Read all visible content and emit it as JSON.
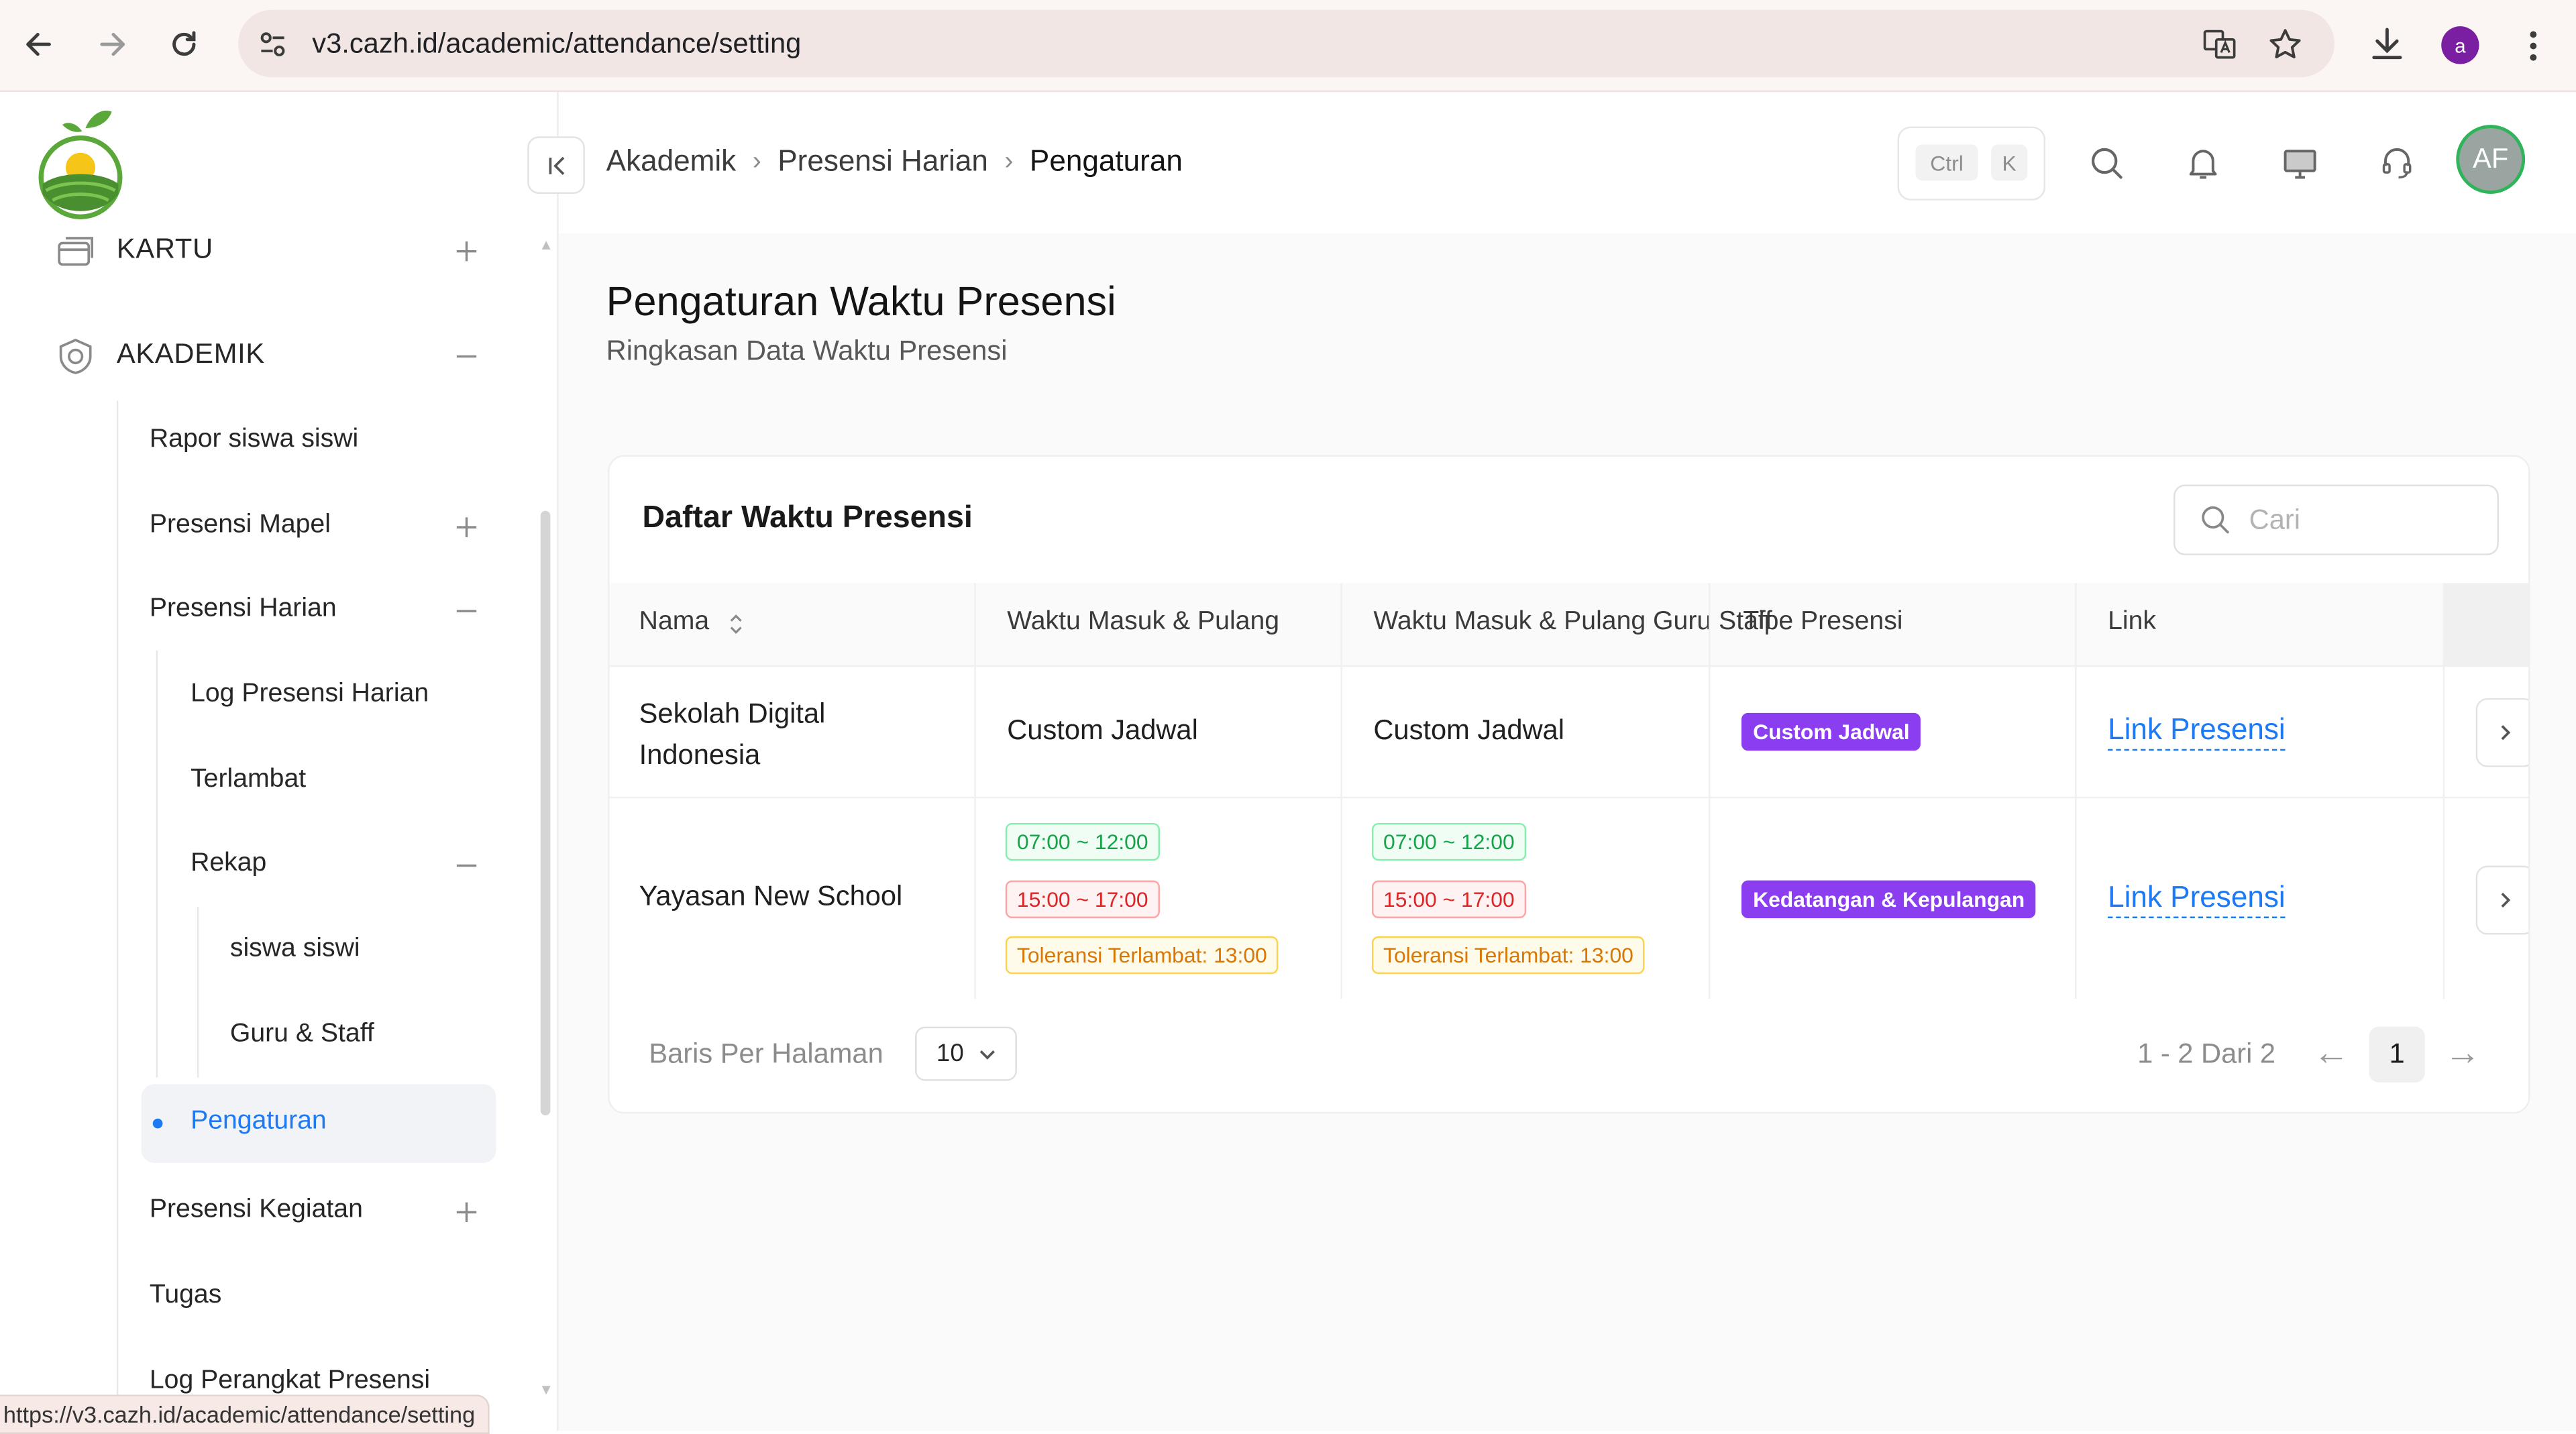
{
  "browser": {
    "url": "v3.cazh.id/academic/attendance/setting",
    "profile_initial": "a",
    "status_url": "https://v3.cazh.id/academic/attendance/setting"
  },
  "sidebar": {
    "kartu": "KARTU",
    "akademik": "AKADEMIK",
    "items": {
      "rapor": "Rapor siswa siswi",
      "presensi_mapel": "Presensi Mapel",
      "presensi_harian": "Presensi Harian",
      "log_harian": "Log Presensi Harian",
      "terlambat": "Terlambat",
      "rekap": "Rekap",
      "siswa": "siswa siswi",
      "guru": "Guru & Staff",
      "pengaturan": "Pengaturan",
      "presensi_kegiatan": "Presensi Kegiatan",
      "tugas": "Tugas",
      "log_perangkat": "Log Perangkat Presensi"
    }
  },
  "header": {
    "breadcrumbs": [
      "Akademik",
      "Presensi Harian",
      "Pengaturan"
    ],
    "kbd_ctrl": "Ctrl",
    "kbd_k": "K",
    "avatar": "AF"
  },
  "page": {
    "title": "Pengaturan Waktu Presensi",
    "subtitle": "Ringkasan Data Waktu Presensi"
  },
  "table": {
    "title": "Daftar Waktu Presensi",
    "search_placeholder": "Cari",
    "columns": [
      "Nama",
      "Waktu Masuk & Pulang",
      "Waktu Masuk & Pulang Guru Staff",
      "Tipe Presensi",
      "Link"
    ],
    "rows": [
      {
        "name": "Sekolah Digital Indonesia",
        "waktu": "Custom Jadwal",
        "waktu_guru": "Custom Jadwal",
        "tipe": "Custom Jadwal",
        "link": "Link Presensi"
      },
      {
        "name": "Yayasan New School",
        "waktu_masuk": "07:00 ~ 12:00",
        "waktu_pulang": "15:00 ~ 17:00",
        "toleransi": "Toleransi Terlambat: 13:00",
        "guru_masuk": "07:00 ~ 12:00",
        "guru_pulang": "15:00 ~ 17:00",
        "guru_toleransi": "Toleransi Terlambat: 13:00",
        "tipe": "Kedatangan & Kepulangan",
        "link": "Link Presensi"
      }
    ]
  },
  "pagination": {
    "rows_label": "Baris Per Halaman",
    "page_size": "10",
    "range": "1 - 2 Dari 2",
    "current": "1"
  },
  "colors": {
    "accent": "#1d7af3",
    "purple_tag": "#8b3df0",
    "avatar_ring": "#2fb45a"
  }
}
